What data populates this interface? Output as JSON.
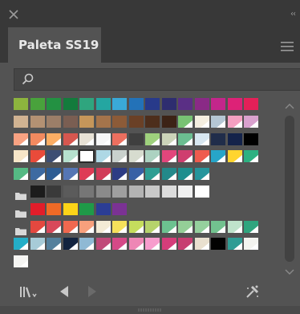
{
  "panel": {
    "tab_label": "Paleta SS19",
    "collapse_label": "‹‹"
  },
  "search": {
    "placeholder": "",
    "value": ""
  },
  "colors": {
    "titlebar": "#383838",
    "panel_bg": "#535353",
    "search_bg": "#454545",
    "icon_gray": "#9a9a9a"
  },
  "swatch_rows": [
    {
      "type": "plain",
      "colors": [
        "#8db43e",
        "#49a23c",
        "#239142",
        "#137b3c",
        "#2fa57e",
        "#24a6a1",
        "#3aa9d8",
        "#2372b8",
        "#283a8a",
        "#2e2d6f",
        "#5a2f85",
        "#8a2a86",
        "#c3268b",
        "#dd2277",
        "#e42058"
      ]
    },
    {
      "type": "mixed",
      "colors": [
        "#d0b392",
        "#b39173",
        "#9b7e68",
        "#7a5e52",
        "#c5965a",
        "#a4744b",
        "#8c5b38",
        "#6a4026",
        "#4d2e1c",
        "#3c2316",
        "#78c273",
        "#f4eee0",
        "#b5c7d4",
        "#f49fc1",
        "#d9a1ce"
      ],
      "tinted": [
        false,
        false,
        false,
        false,
        false,
        false,
        false,
        false,
        false,
        false,
        true,
        true,
        true,
        true,
        true
      ]
    },
    {
      "type": "mixed",
      "colors": [
        "#f8a282",
        "#f28a5f",
        "#fcae64",
        "#d7574f",
        "#e8e2d5",
        "#f7f7f7",
        "#ec6f5f",
        "#3f3f3f",
        "#9fd17d",
        "#cbd4b9",
        "#6bbe91",
        "#d8e7f1",
        "#202d4a",
        "#14234a",
        "#000000"
      ],
      "tinted": [
        true,
        true,
        true,
        true,
        true,
        true,
        true,
        false,
        true,
        true,
        true,
        true,
        false,
        false,
        false
      ]
    },
    {
      "type": "mixed",
      "colors": [
        "#f7e6c8",
        "#e94b3a",
        "#3d4e73",
        "#b6e1ce",
        "#ffffff",
        "#aed8e5",
        "#c9d1cd",
        "#d7dccf",
        "#acd2c1",
        "#e2467c",
        "#cf3e6f",
        "#ef5b4e",
        "#27a5c8",
        "#ffd52e",
        "#2db181"
      ],
      "tinted": [
        true,
        true,
        true,
        true,
        false,
        true,
        true,
        true,
        true,
        true,
        true,
        true,
        true,
        true,
        true
      ],
      "selected": 4
    },
    {
      "type": "mixed",
      "colors": [
        "#55ba84",
        "#3d6aa1",
        "#2d5c93",
        "#5576b4",
        "#de3b55",
        "#d13c59",
        "#2d3c84",
        "#3860a5",
        "#2d9e93",
        "#23898a",
        "#1d8e8e",
        "#25959c"
      ],
      "tinted": [
        true,
        true,
        true,
        true,
        true,
        true,
        true,
        true,
        true,
        true,
        true,
        true
      ]
    },
    {
      "type": "group",
      "colors": [
        "#1c1c1c",
        "#3a3a3a",
        "#5b5b5b",
        "#767676",
        "#8a8a8a",
        "#9f9f9f",
        "#b3b3b3",
        "#c8c8c8",
        "#dcdcdc",
        "#f0f0f0",
        "#ffffff"
      ]
    },
    {
      "type": "group",
      "colors": [
        "#e21d2a",
        "#ef6a26",
        "#fcd418",
        "#1f9a48",
        "#2b3d95",
        "#7b3294"
      ]
    },
    {
      "type": "group_mixed",
      "colors": [
        "#e4483f",
        "#d8495a",
        "#f0684f",
        "#f8a07c",
        "#f3ebd6",
        "#f6e05b",
        "#c5dd5d",
        "#b6d36b",
        "#6cc290",
        "#94cf97",
        "#95d09d",
        "#72c28f",
        "#bfe3cb",
        "#2fa57e"
      ],
      "tinted": [
        true,
        true,
        true,
        true,
        true,
        true,
        true,
        true,
        true,
        true,
        true,
        true,
        true,
        true
      ]
    },
    {
      "type": "mixed",
      "colors": [
        "#24aec7",
        "#a7cbd7",
        "#54809c",
        "#12233f",
        "#8fb9d4",
        "#c04a79",
        "#d54987",
        "#ee87b5",
        "#f79dcd",
        "#d53d7a",
        "#c73e71",
        "#e9e0cf",
        "#020202",
        "#2f9c94",
        "#f4f4f0"
      ],
      "tinted": [
        true,
        true,
        true,
        true,
        true,
        true,
        true,
        true,
        true,
        true,
        true,
        true,
        false,
        true,
        true
      ]
    },
    {
      "type": "mixed",
      "colors": [
        "#f5f5f3"
      ],
      "tinted": [
        true
      ]
    }
  ],
  "icons": {
    "close": "close-icon",
    "menu": "hamburger-menu-icon",
    "search": "search-icon",
    "libraries": "swatch-libraries-icon",
    "prev": "previous-arrow-icon",
    "next": "next-arrow-icon",
    "tools": "color-tools-icon"
  }
}
